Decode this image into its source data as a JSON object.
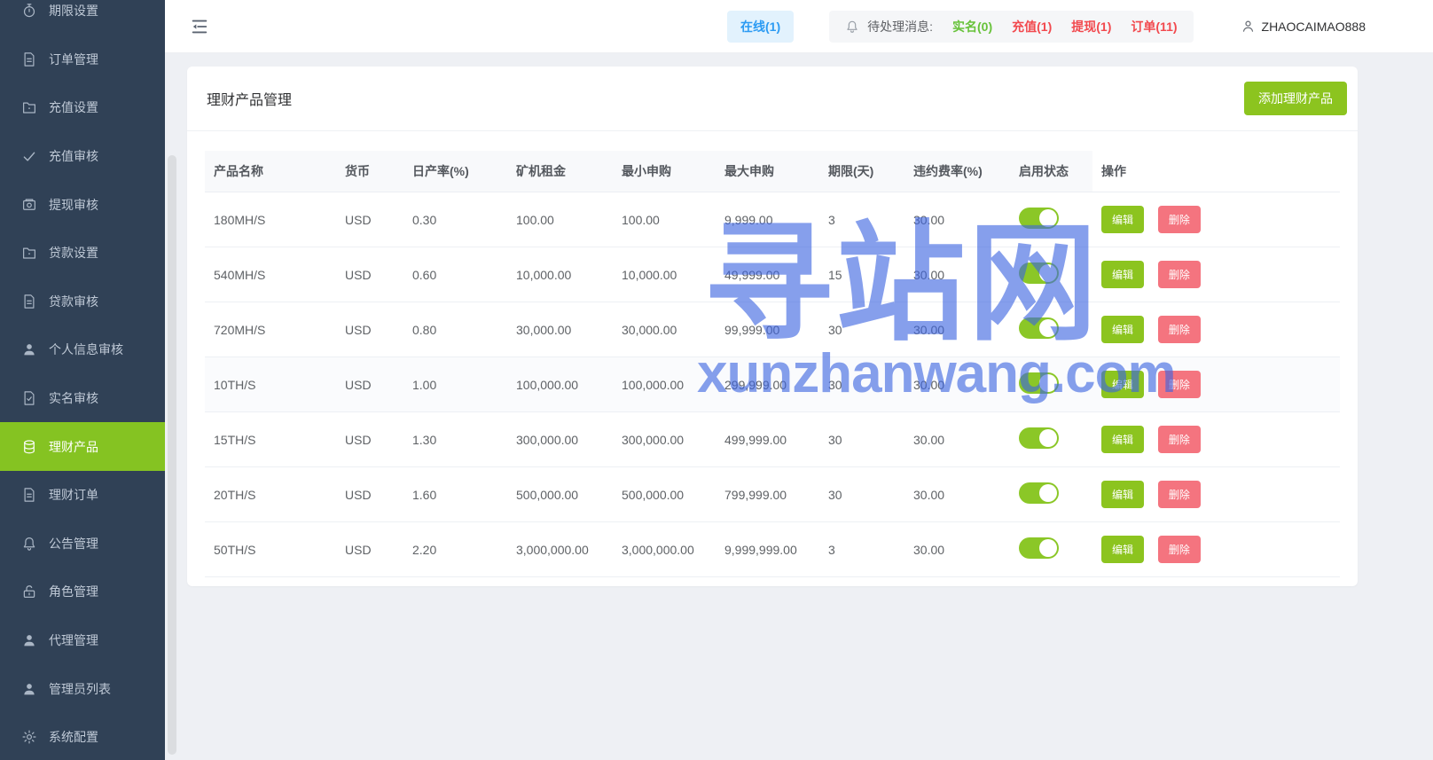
{
  "sidebar": {
    "items": [
      {
        "label": "期限设置",
        "icon": "timer-icon",
        "active": false
      },
      {
        "label": "订单管理",
        "icon": "file-icon",
        "active": false
      },
      {
        "label": "充值设置",
        "icon": "folder-icon",
        "active": false
      },
      {
        "label": "充值审核",
        "icon": "check-icon",
        "active": false
      },
      {
        "label": "提现审核",
        "icon": "wallet-icon",
        "active": false
      },
      {
        "label": "贷款设置",
        "icon": "folder-icon",
        "active": false
      },
      {
        "label": "贷款审核",
        "icon": "file-icon",
        "active": false
      },
      {
        "label": "个人信息审核",
        "icon": "user-icon",
        "active": false
      },
      {
        "label": "实名审核",
        "icon": "file-check-icon",
        "active": false
      },
      {
        "label": "理财产品",
        "icon": "database-icon",
        "active": true
      },
      {
        "label": "理财订单",
        "icon": "file-icon",
        "active": false
      },
      {
        "label": "公告管理",
        "icon": "bell-icon",
        "active": false
      },
      {
        "label": "角色管理",
        "icon": "lock-icon",
        "active": false
      },
      {
        "label": "代理管理",
        "icon": "user-icon",
        "active": false
      },
      {
        "label": "管理员列表",
        "icon": "user-icon",
        "active": false
      },
      {
        "label": "系统配置",
        "icon": "gear-icon",
        "active": false
      }
    ]
  },
  "header": {
    "online_badge": "在线(1)",
    "pending_label": "待处理消息:",
    "pending_items": [
      {
        "label": "实名(0)",
        "type": "success"
      },
      {
        "label": "充值(1)",
        "type": "danger"
      },
      {
        "label": "提现(1)",
        "type": "danger"
      },
      {
        "label": "订单(11)",
        "type": "danger"
      }
    ],
    "username": "ZHAOCAIMAO888"
  },
  "main": {
    "card_title": "理财产品管理",
    "add_button_label": "添加理财产品",
    "table": {
      "columns": [
        "产品名称",
        "货币",
        "日产率(%)",
        "矿机租金",
        "最小申购",
        "最大申购",
        "期限(天)",
        "违约费率(%)",
        "启用状态",
        "操作"
      ],
      "edit_label": "编辑",
      "delete_label": "删除",
      "rows": [
        {
          "name": "180MH/S",
          "currency": "USD",
          "daily_rate": "0.30",
          "rent": "100.00",
          "min": "100.00",
          "max": "9,999.00",
          "days": "3",
          "penalty": "30.00",
          "enabled": true,
          "highlighted": false
        },
        {
          "name": "540MH/S",
          "currency": "USD",
          "daily_rate": "0.60",
          "rent": "10,000.00",
          "min": "10,000.00",
          "max": "49,999.00",
          "days": "15",
          "penalty": "30.00",
          "enabled": true,
          "highlighted": false
        },
        {
          "name": "720MH/S",
          "currency": "USD",
          "daily_rate": "0.80",
          "rent": "30,000.00",
          "min": "30,000.00",
          "max": "99,999.00",
          "days": "30",
          "penalty": "30.00",
          "enabled": true,
          "highlighted": false
        },
        {
          "name": "10TH/S",
          "currency": "USD",
          "daily_rate": "1.00",
          "rent": "100,000.00",
          "min": "100,000.00",
          "max": "299,999.00",
          "days": "30",
          "penalty": "30.00",
          "enabled": true,
          "highlighted": true
        },
        {
          "name": "15TH/S",
          "currency": "USD",
          "daily_rate": "1.30",
          "rent": "300,000.00",
          "min": "300,000.00",
          "max": "499,999.00",
          "days": "30",
          "penalty": "30.00",
          "enabled": true,
          "highlighted": false
        },
        {
          "name": "20TH/S",
          "currency": "USD",
          "daily_rate": "1.60",
          "rent": "500,000.00",
          "min": "500,000.00",
          "max": "799,999.00",
          "days": "30",
          "penalty": "30.00",
          "enabled": true,
          "highlighted": false
        },
        {
          "name": "50TH/S",
          "currency": "USD",
          "daily_rate": "2.20",
          "rent": "3,000,000.00",
          "min": "3,000,000.00",
          "max": "9,999,999.00",
          "days": "3",
          "penalty": "30.00",
          "enabled": true,
          "highlighted": false
        }
      ]
    }
  },
  "watermark": {
    "cn": "寻站网",
    "en": "xunzhanwang.com"
  },
  "colors": {
    "sidebar_bg": "#304156",
    "active_green": "#85c322",
    "button_green": "#8cc41f",
    "delete_red": "#f4747f",
    "toggle_green": "#8bc727",
    "online_blue": "#2b9bf3",
    "online_bg": "#e2f2fd",
    "success_green": "#67c23a",
    "danger_red": "#f2494e",
    "watermark_blue": "rgba(60,100,225,0.62)"
  }
}
